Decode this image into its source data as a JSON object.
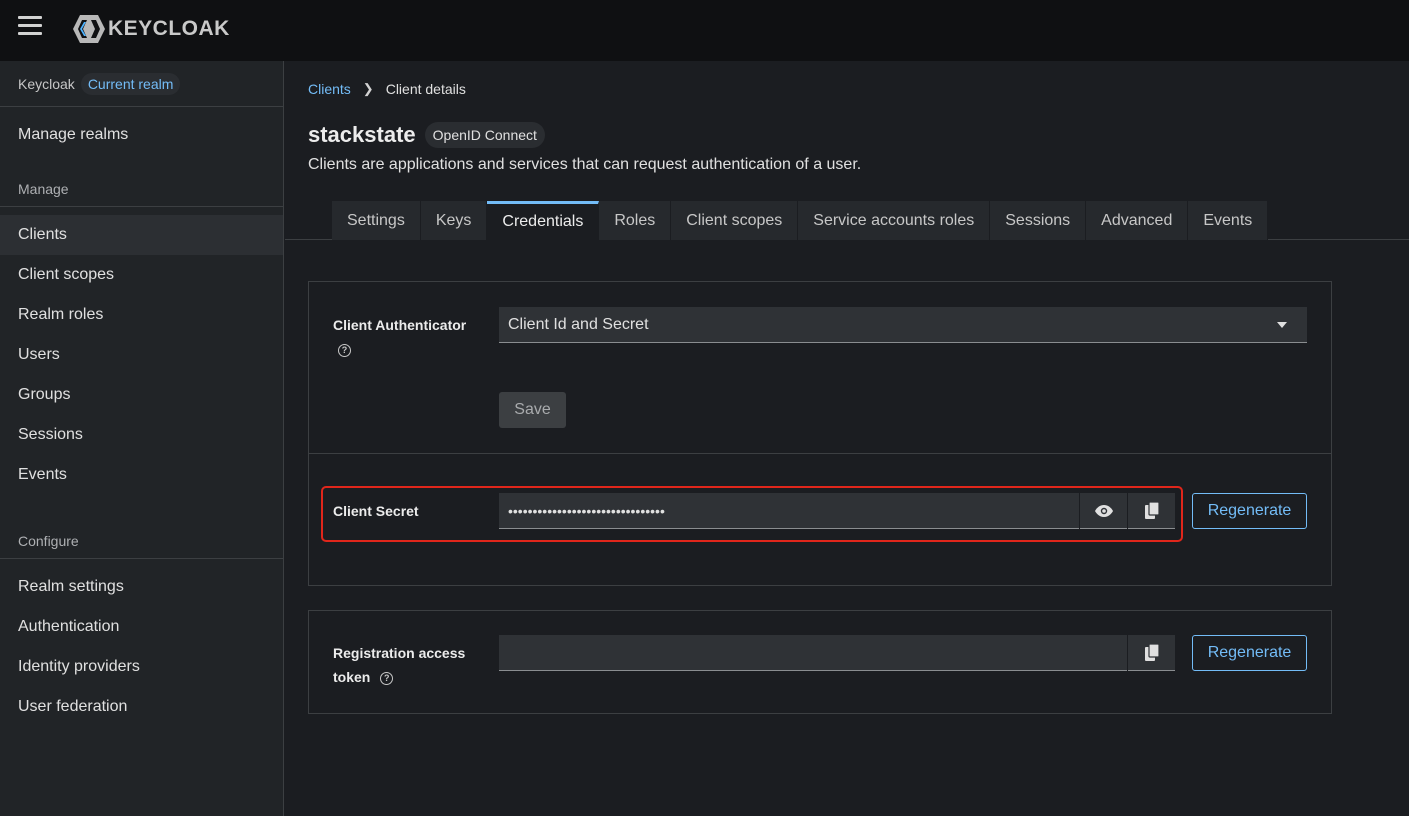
{
  "header": {
    "logo_text": "KEYCLOAK"
  },
  "sidebar": {
    "realm_name": "Keycloak",
    "realm_badge": "Current realm",
    "manage_realms": "Manage realms",
    "manage_title": "Manage",
    "manage_items": [
      "Clients",
      "Client scopes",
      "Realm roles",
      "Users",
      "Groups",
      "Sessions",
      "Events"
    ],
    "configure_title": "Configure",
    "configure_items": [
      "Realm settings",
      "Authentication",
      "Identity providers",
      "User federation"
    ]
  },
  "breadcrumb": {
    "link": "Clients",
    "current": "Client details"
  },
  "page": {
    "title": "stackstate",
    "protocol": "OpenID Connect",
    "subtitle": "Clients are applications and services that can request authentication of a user."
  },
  "tabs": [
    "Settings",
    "Keys",
    "Credentials",
    "Roles",
    "Client scopes",
    "Service accounts roles",
    "Sessions",
    "Advanced",
    "Events"
  ],
  "active_tab": "Credentials",
  "credentials": {
    "authenticator_label": "Client Authenticator",
    "authenticator_value": "Client Id and Secret",
    "save_label": "Save",
    "secret_label": "Client Secret",
    "secret_value": "••••••••••••••••••••••••••••••••",
    "regenerate_label": "Regenerate",
    "token_label_line1": "Registration access",
    "token_label_line2": "token",
    "token_regenerate_label": "Regenerate",
    "help_icon": "?"
  },
  "colors": {
    "accent": "#73bcf7",
    "highlight": "#e0261b"
  }
}
